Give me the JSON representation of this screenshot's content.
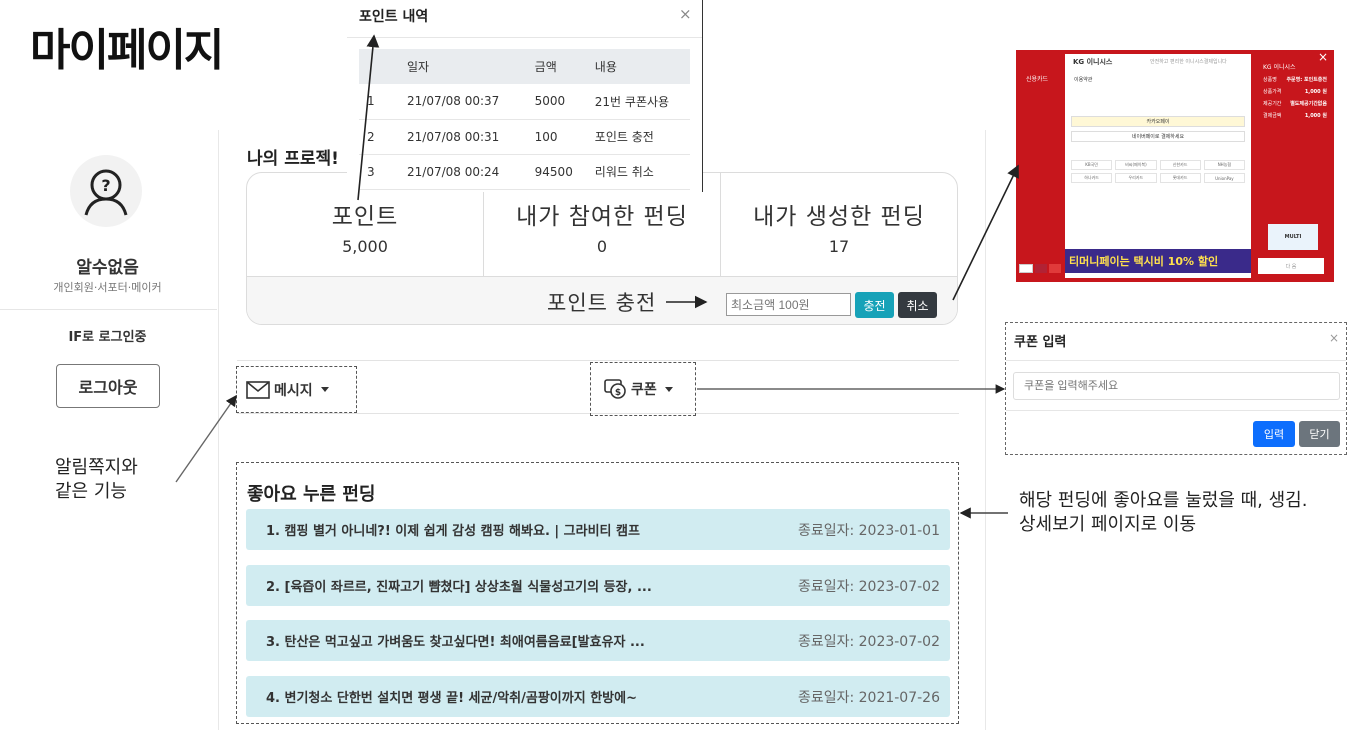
{
  "page": {
    "title": "마이페이지"
  },
  "profile": {
    "name": "알수없음",
    "role": "개인회원·서포터·메이커",
    "login_state": "IF로 로그인중",
    "logout_label": "로그아웃"
  },
  "annotations": {
    "left_note": [
      "알림쪽지와",
      "같은 기능"
    ],
    "right_note": [
      "해당 펀딩에 좋아요를 눌렀을 때, 생김.",
      "상세보기 페이지로 이동"
    ]
  },
  "projects": {
    "title": "나의 프로젝!",
    "stats": [
      {
        "label": "포인트",
        "value": "5,000"
      },
      {
        "label": "내가 참여한 펀딩",
        "value": "0"
      },
      {
        "label": "내가 생성한 펀딩",
        "value": "17"
      }
    ],
    "charge_label": "포인트 충전",
    "min_placeholder": "최소금액 100원",
    "charge_button": "충전",
    "cancel_button": "취소"
  },
  "toolbar": {
    "message_label": "메시지",
    "coupon_label": "쿠폰"
  },
  "liked": {
    "title": "좋아요 누른 펀딩",
    "items": [
      {
        "name": "1. 캠핑 별거 아니네?! 이제 쉽게 감성 캠핑 해봐요. | 그라비티 캠프",
        "date": "종료일자: 2023-01-01"
      },
      {
        "name": "2. [육즙이 좌르르, 진짜고기 뺨쳤다] 상상초월 식물성고기의 등장, ...",
        "date": "종료일자: 2023-07-02"
      },
      {
        "name": "3. 탄산은 먹고싶고 가벼움도 찾고싶다면! 최애여름음료[발효유자 ...",
        "date": "종료일자: 2023-07-02"
      },
      {
        "name": "4. 변기청소 단한번 설치면 평생 끝! 세균/악취/곰팡이까지 한방에~",
        "date": "종료일자: 2021-07-26"
      }
    ]
  },
  "points_modal": {
    "title": "포인트 내역",
    "close": "×",
    "columns": [
      "",
      "일자",
      "금액",
      "내용"
    ],
    "rows": [
      [
        "1",
        "21/07/08 00:37",
        "5000",
        "21번 쿠폰사용"
      ],
      [
        "2",
        "21/07/08 00:31",
        "100",
        "포인트 충전"
      ],
      [
        "3",
        "21/07/08 00:24",
        "94500",
        "리워드 취소"
      ]
    ]
  },
  "payment_popup": {
    "side_label": "신용카드",
    "brand": "KG 이니시스",
    "subtitle": "안전하고 편리한 이니시스결제입니다",
    "agree": "이용약관",
    "kakao": "카카오페이",
    "naver": "네이버페이로 결제하세요",
    "cards": [
      "KB국민",
      "비씨(페이북)",
      "신한카드",
      "NH농협",
      "하나카드",
      "우리카드",
      "롯데카드",
      "UnionPay"
    ],
    "banner": "티머니페이는 택시비 10% 할인",
    "summary_title": "KG 이니시스",
    "summary": [
      {
        "k": "상품명",
        "v": "주문명: 포인트충전"
      },
      {
        "k": "상품가격",
        "v": "1,000 원"
      },
      {
        "k": "제공기간",
        "v": "별도제공기간없음"
      },
      {
        "k": "결제금액",
        "v": "1,000 원"
      }
    ],
    "ad": "MULTI",
    "confirm": "다 음",
    "close": "×"
  },
  "coupon_modal": {
    "title": "쿠폰 입력",
    "close": "×",
    "placeholder": "쿠폰을 입력해주세요",
    "ok": "입력",
    "cancel": "닫기"
  }
}
